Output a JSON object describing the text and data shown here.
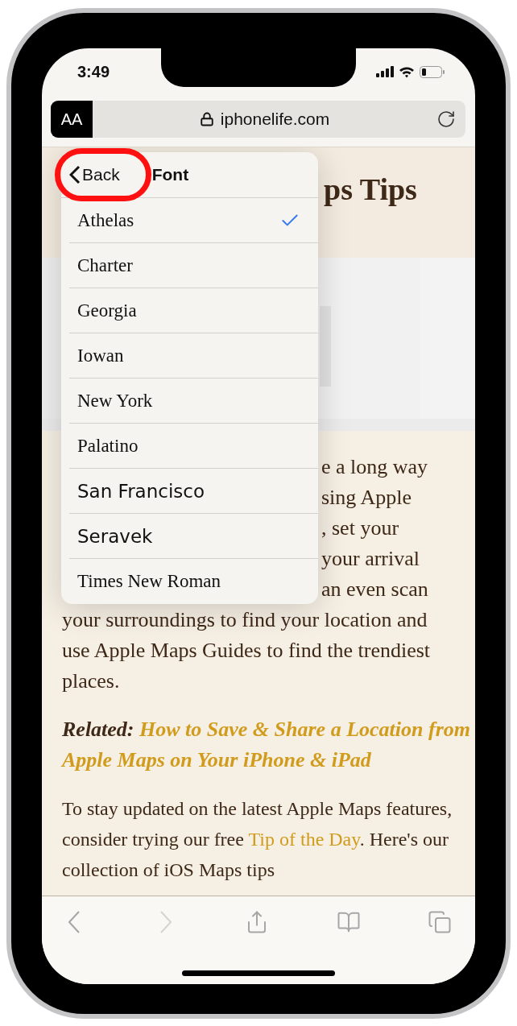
{
  "status_bar": {
    "time": "3:49"
  },
  "address_bar": {
    "reader_button": "AA",
    "url": "iphonelife.com"
  },
  "font_menu": {
    "back": "Back",
    "title": "Font",
    "fonts": [
      {
        "name": "Athelas",
        "kind": "serif",
        "selected": true
      },
      {
        "name": "Charter",
        "kind": "serif",
        "selected": false
      },
      {
        "name": "Georgia",
        "kind": "serif",
        "selected": false
      },
      {
        "name": "Iowan",
        "kind": "serif",
        "selected": false
      },
      {
        "name": "New York",
        "kind": "serif",
        "selected": false
      },
      {
        "name": "Palatino",
        "kind": "serif",
        "selected": false
      },
      {
        "name": "San Francisco",
        "kind": "sans",
        "selected": false
      },
      {
        "name": "Seravek",
        "kind": "sans",
        "selected": false
      },
      {
        "name": "Times New Roman",
        "kind": "serif",
        "selected": false
      }
    ]
  },
  "article": {
    "title_fragment": "ps Tips",
    "covered_lines": [
      "e a long way",
      "sing Apple",
      ", set your",
      "your arrival",
      "an even scan"
    ],
    "paragraph": "your surroundings to find your location and use Apple Maps Guides to find the trendiest places.",
    "related": {
      "label": "Related:",
      "link_lines": [
        "How to Save & Share a Location from",
        "Apple Maps on Your iPhone & iPad"
      ]
    },
    "closing": {
      "before": "To stay updated on the latest Apple Maps features, consider trying our free ",
      "link": "Tip of the Day",
      "after": ". Here's our collection of iOS Maps tips"
    }
  },
  "toolbar": [
    {
      "kind": "back",
      "disabled": false
    },
    {
      "kind": "forward",
      "disabled": true
    },
    {
      "kind": "share",
      "disabled": false
    },
    {
      "kind": "bookmarks",
      "disabled": false
    },
    {
      "kind": "tabs",
      "disabled": false
    }
  ]
}
